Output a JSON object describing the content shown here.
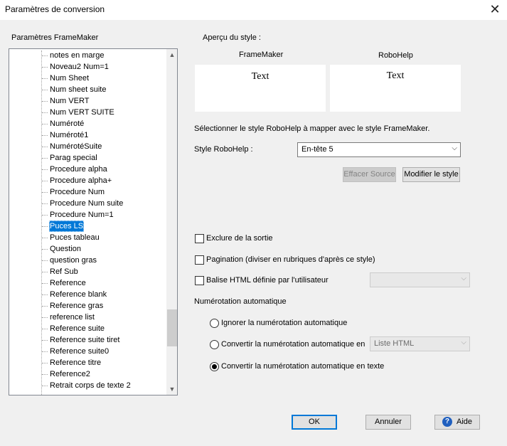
{
  "window": {
    "title": "Paramètres de conversion"
  },
  "left_panel": {
    "label": "Paramètres FrameMaker",
    "items": [
      "notes en marge",
      "Noveau2 Num=1",
      "Num Sheet",
      "Num sheet suite",
      "Num VERT",
      "Num VERT SUITE",
      "Numéroté",
      "Numéroté1",
      "NumérotéSuite",
      "Parag special",
      "Procedure alpha",
      "Procedure alpha+",
      "Procedure Num",
      "Procedure Num suite",
      "Procedure Num=1",
      "Puces LS",
      "Puces tableau",
      "Question",
      "question gras",
      "Ref Sub",
      "Reference",
      "Reference blank",
      "Reference gras",
      "reference list",
      "Reference suite",
      "Reference suite tiret",
      "Reference suite0",
      "Reference titre",
      "Reference2",
      "Retrait corps de texte 2"
    ],
    "selected": "Puces LS"
  },
  "preview": {
    "label": "Aperçu du style :",
    "framemaker_label": "FrameMaker",
    "robohelp_label": "RoboHelp",
    "framemaker_text": "Text",
    "robohelp_text": "Text"
  },
  "mapping": {
    "instruction": "Sélectionner le style RoboHelp à mapper avec le style FrameMaker.",
    "style_label": "Style RoboHelp :",
    "style_value": "En-tête 5",
    "clear_source": "Effacer Source",
    "modify_style": "Modifier le style"
  },
  "options": {
    "exclude": "Exclure de la sortie",
    "pagination": "Pagination (diviser en rubriques d'après ce style)",
    "html_tag": "Balise HTML définie par l'utilisateur",
    "html_tag_value": ""
  },
  "numbering": {
    "label": "Numérotation automatique",
    "ignore": "Ignorer la numérotation automatique",
    "convert_to": "Convertir la numérotation automatique en",
    "convert_to_value": "Liste HTML",
    "convert_text": "Convertir la numérotation automatique en texte",
    "selected": "convert_text"
  },
  "footer": {
    "ok": "OK",
    "cancel": "Annuler",
    "help": "Aide"
  },
  "colors": {
    "selection": "#0078d7",
    "dialog_bg": "#f0f0f0"
  }
}
